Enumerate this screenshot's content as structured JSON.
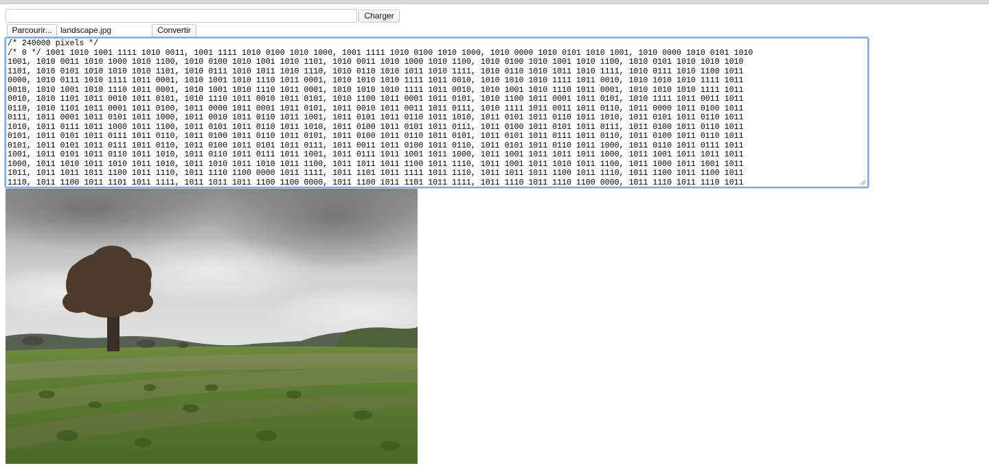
{
  "form": {
    "url_value": "",
    "url_placeholder": "",
    "load_button": "Charger",
    "browse_button": "Parcourir...",
    "file_name": "landscape.jpg",
    "convert_button": "Convertir"
  },
  "output": {
    "lines": [
      "/* 240000 pixels */",
      "/* 0 */ 1001 1010 1001 1111 1010 0011, 1001 1111 1010 0100 1010 1000, 1001 1111 1010 0100 1010 1000, 1010 0000 1010 0101 1010 1001, 1010 0000 1010 0101 1010",
      "1001, 1010 0011 1010 1000 1010 1100, 1010 0100 1010 1001 1010 1101, 1010 0011 1010 1000 1010 1100, 1010 0100 1010 1001 1010 1100, 1010 0101 1010 1010 1010",
      "1101, 1010 0101 1010 1010 1010 1101, 1010 0111 1010 1011 1010 1110, 1010 0110 1010 1011 1010 1111, 1010 0110 1010 1011 1010 1111, 1010 0111 1010 1100 1011",
      "0000, 1010 0111 1010 1111 1011 0001, 1010 1001 1010 1110 1011 0001, 1010 1010 1010 1111 1011 0010, 1010 1010 1010 1111 1011 0010, 1010 1010 1010 1111 1011",
      "0010, 1010 1001 1010 1110 1011 0001, 1010 1001 1010 1110 1011 0001, 1010 1010 1010 1111 1011 0010, 1010 1001 1010 1110 1011 0001, 1010 1010 1010 1111 1011",
      "0010, 1010 1101 1011 0010 1011 0101, 1010 1110 1011 0010 1011 0101, 1010 1100 1011 0001 1011 0101, 1010 1100 1011 0001 1011 0101, 1010 1111 1011 0011 1011",
      "0110, 1010 1101 1011 0001 1011 0100, 1011 0000 1011 0001 1011 0101, 1011 0010 1011 0011 1011 0111, 1010 1111 1011 0011 1011 0110, 1011 0000 1011 0100 1011",
      "0111, 1011 0001 1011 0101 1011 1000, 1011 0010 1011 0110 1011 1001, 1011 0101 1011 0110 1011 1010, 1011 0101 1011 0110 1011 1010, 1011 0101 1011 0110 1011",
      "1010, 1011 0111 1011 1000 1011 1100, 1011 0101 1011 0110 1011 1010, 1011 0100 1011 0101 1011 0111, 1011 0100 1011 0101 1011 0111, 1011 0100 1011 0110 1011",
      "0101, 1011 0101 1011 0111 1011 0110, 1011 0100 1011 0110 1011 0101, 1011 0100 1011 0110 1011 0101, 1011 0101 1011 0111 1011 0110, 1011 0100 1011 0110 1011",
      "0101, 1011 0101 1011 0111 1011 0110, 1011 0100 1011 0101 1011 0111, 1011 0011 1011 0100 1011 0110, 1011 0101 1011 0110 1011 1000, 1011 0110 1011 0111 1011",
      "1001, 1011 0101 1011 0110 1011 1010, 1011 0110 1011 0111 1011 1001, 1011 0111 1011 1001 1011 1000, 1011 1001 1011 1011 1011 1000, 1011 1001 1011 1011 1011",
      "1000, 1011 1010 1011 1010 1011 1010, 1011 1010 1011 1010 1011 1100, 1011 1011 1011 1100 1011 1110, 1011 1001 1011 1010 1011 1100, 1011 1000 1011 1001 1011",
      "1011, 1011 1011 1011 1100 1011 1110, 1011 1110 1100 0000 1011 1111, 1011 1101 1011 1111 1011 1110, 1011 1011 1011 1100 1011 1110, 1011 1100 1011 1100 1011",
      "1110, 1011 1100 1011 1101 1011 1111, 1011 1011 1011 1100 1100 0000, 1011 1100 1011 1101 1011 1111, 1011 1110 1011 1110 1100 0000, 1011 1110 1011 1110 1011"
    ]
  }
}
